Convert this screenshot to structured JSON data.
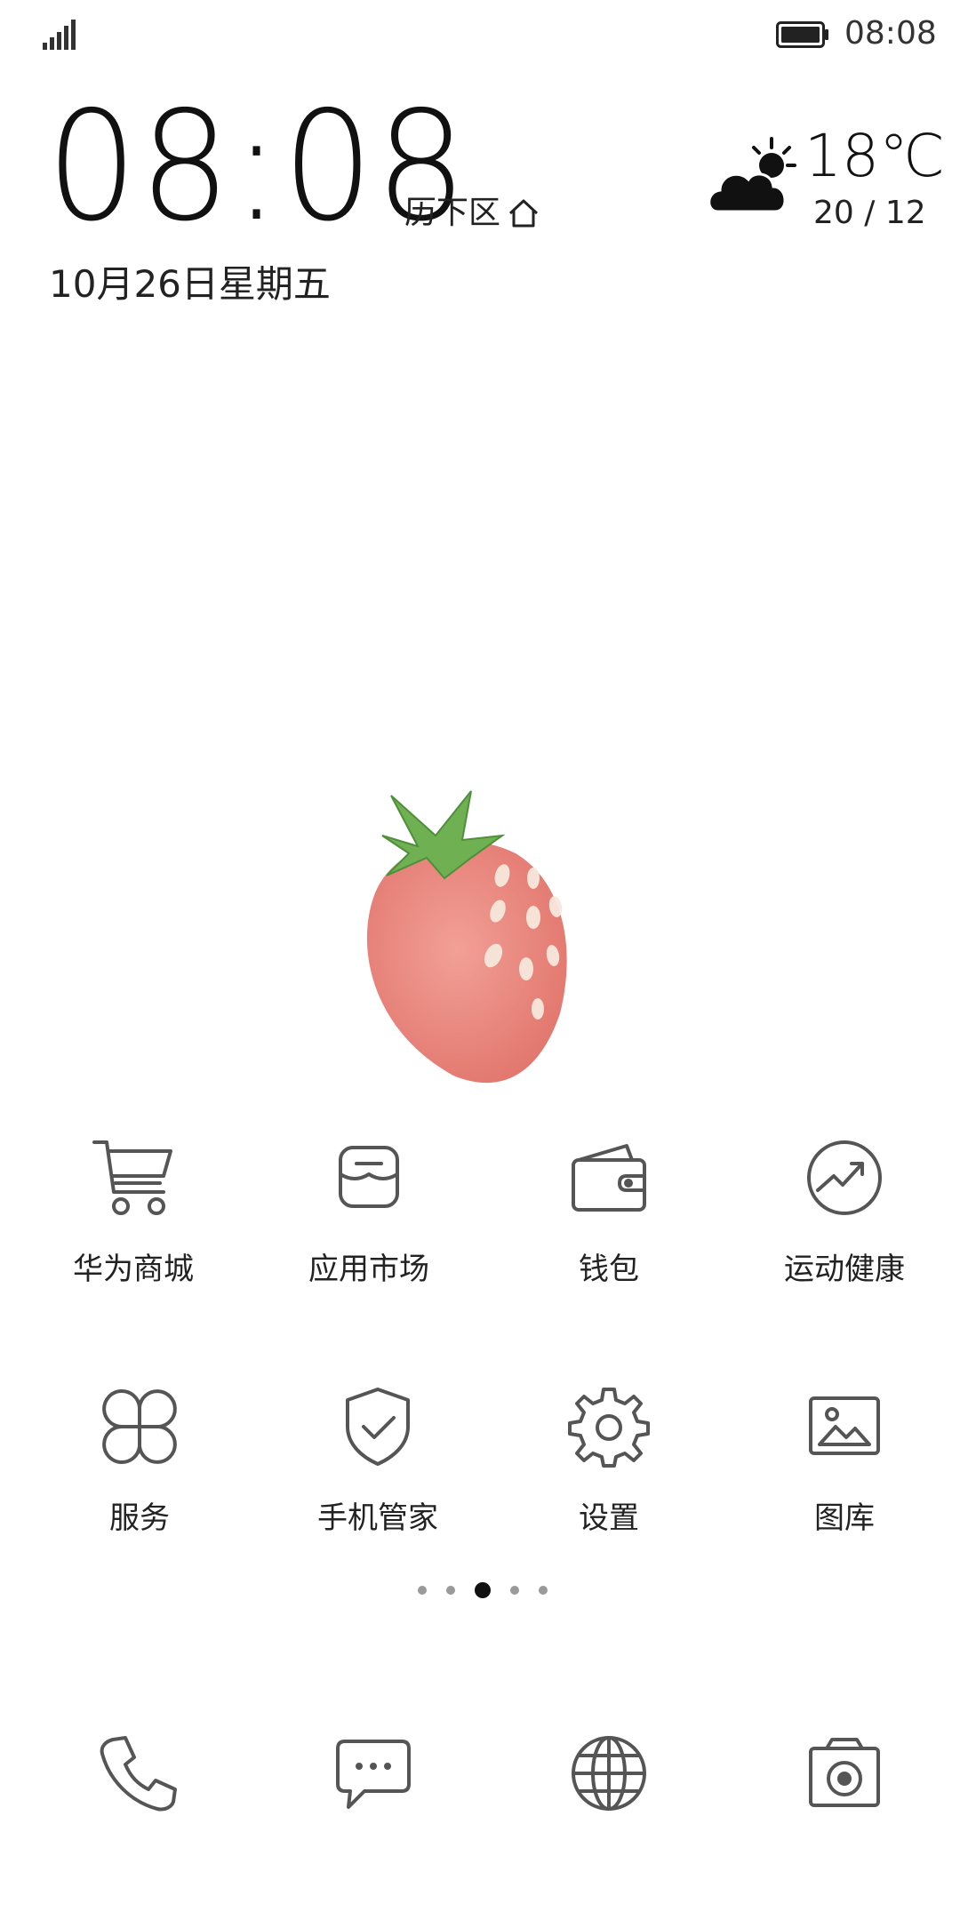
{
  "status_bar": {
    "time": "08:08",
    "signal_icon": "signal-icon",
    "battery_icon": "battery-icon"
  },
  "clock_widget": {
    "time": "08:08",
    "location": "历下区",
    "home_icon": "home-icon",
    "date": "10月26日星期五"
  },
  "weather": {
    "icon": "partly-cloudy-icon",
    "temperature": "18℃",
    "range": "20 / 12"
  },
  "wallpaper": {
    "illustration": "strawberry"
  },
  "apps": [
    {
      "label": "华为商城",
      "icon": "shopping-cart-icon"
    },
    {
      "label": "应用市场",
      "icon": "app-store-icon"
    },
    {
      "label": "钱包",
      "icon": "wallet-icon"
    },
    {
      "label": "运动健康",
      "icon": "health-trend-icon"
    },
    {
      "label": "服务",
      "icon": "clover-services-icon"
    },
    {
      "label": "手机管家",
      "icon": "shield-check-icon"
    },
    {
      "label": "设置",
      "icon": "gear-icon"
    },
    {
      "label": "图库",
      "icon": "gallery-icon"
    }
  ],
  "page_indicator": {
    "pages": 5,
    "current": 3
  },
  "dock": [
    {
      "icon": "phone-icon"
    },
    {
      "icon": "message-icon"
    },
    {
      "icon": "browser-globe-icon"
    },
    {
      "icon": "camera-icon"
    }
  ]
}
